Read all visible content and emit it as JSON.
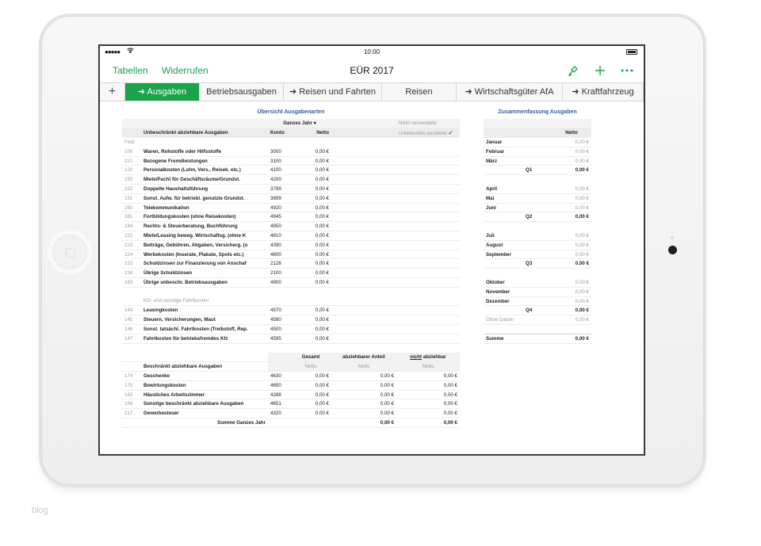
{
  "footer": {
    "watermark": "blog"
  },
  "status": {
    "signal": "●●●●●",
    "time": "10:00"
  },
  "toolbar": {
    "left": [
      "Tabellen",
      "Widerrufen"
    ],
    "title": "EÜR 2017"
  },
  "tabs": [
    "➜ Ausgaben",
    "Betriebsausgaben",
    "➜ Reisen und Fahrten",
    "Reisen",
    "➜ Wirtschaftsgüter AfA",
    "➜ Kraftfahrzeug"
  ],
  "active_tab": 0,
  "overview": {
    "title": "Übersicht Ausgabenarten",
    "period": "Ganzes Jahr ▾",
    "option_unused": "Nicht verwendete",
    "option_hide": "Unterkonten ausblend",
    "option_check": "✓",
    "header": {
      "label": "Unbeschränkt abziehbare Ausgaben",
      "konto": "Konto",
      "netto": "Netto"
    },
    "feld": "Feld",
    "rows": [
      {
        "feld": "100",
        "label": "Waren, Rohstoffe oder Hilfsstoffe",
        "konto": "3000",
        "netto": "0,00 €"
      },
      {
        "feld": "110",
        "label": "Bezogene Fremdleistungen",
        "konto": "3100",
        "netto": "0,00 €"
      },
      {
        "feld": "120",
        "label": "Personalkosten (Lohn, Vers., Reisek. etc.)",
        "konto": "4100",
        "netto": "0,00 €"
      },
      {
        "feld": "150",
        "label": "Miete/Pacht für Geschäftsräume/Grundst.",
        "konto": "4200",
        "netto": "0,00 €"
      },
      {
        "feld": "152",
        "label": "Doppelte Haushaltsführung",
        "konto": "3799",
        "netto": "0,00 €"
      },
      {
        "feld": "151",
        "label": "Sonst. Aufw. für betriebl. genutzte Grundst.",
        "konto": "3899",
        "netto": "0,00 €"
      },
      {
        "feld": "280",
        "label": "Telekommunikation",
        "konto": "4920",
        "netto": "0,00 €"
      },
      {
        "feld": "281",
        "label": "Fortbildungskosten (ohne Reisekosten)",
        "konto": "4945",
        "netto": "0,00 €"
      },
      {
        "feld": "184",
        "label": "Rechts- & Steuerberatung, Buchführung",
        "konto": "4950",
        "netto": "0,00 €"
      },
      {
        "feld": "222",
        "label": "Miete/Leasing beweg. Wirtschaftsg. (ohne K",
        "konto": "4810",
        "netto": "0,00 €"
      },
      {
        "feld": "223",
        "label": "Beiträge, Gebühren, Abgaben, Versicherg. (o",
        "konto": "4390",
        "netto": "0,00 €"
      },
      {
        "feld": "224",
        "label": "Werbekosten (Inserate, Plakate, Spots etc.)",
        "konto": "4600",
        "netto": "0,00 €"
      },
      {
        "feld": "232",
        "label": "Schuldzinsen zur Finanzierung von Anschaf",
        "konto": "2126",
        "netto": "0,00 €"
      },
      {
        "feld": "234",
        "label": "Übrige Schuldzinsen",
        "konto": "2100",
        "netto": "0,00 €"
      },
      {
        "feld": "183",
        "label": "Übrige unbeschr. Betriebsausgaben",
        "konto": "4900",
        "netto": "0,00 €"
      }
    ],
    "kfz_label": "Kfz- und sonstige Fahrtkosten",
    "kfz_rows": [
      {
        "feld": "144",
        "label": "Leasingkosten",
        "konto": "4570",
        "netto": "0,00 €"
      },
      {
        "feld": "145",
        "label": "Steuern, Versicherungen, Maut",
        "konto": "4580",
        "netto": "0,00 €"
      },
      {
        "feld": "146",
        "label": "Sonst. tatsächl. Fahrtkosten (Treibstoff, Rep.",
        "konto": "4500",
        "netto": "0,00 €"
      },
      {
        "feld": "147",
        "label": "Fahrtkosten für betriebsfremdes Kfz",
        "konto": "4595",
        "netto": "0,00 €"
      }
    ],
    "beschr": {
      "label": "Beschränkt abziehbare Ausgaben",
      "col_gesamt": "Gesamt",
      "col_anteil": "abziehbarer Anteil",
      "col_nicht": "nicht",
      "col_nicht_rest": " abziehbar",
      "netto": "Netto",
      "rows": [
        {
          "feld": "174",
          "label": "Geschenke",
          "konto": "4630",
          "gesamt": "0,00 €",
          "anteil": "0,00 €",
          "nicht": "0,00 €"
        },
        {
          "feld": "175",
          "label": "Bewirtungskosten",
          "konto": "4650",
          "gesamt": "0,00 €",
          "anteil": "0,00 €",
          "nicht": "0,00 €"
        },
        {
          "feld": "162",
          "label": "Häusliches Arbeitszimmer",
          "konto": "4288",
          "gesamt": "0,00 €",
          "anteil": "0,00 €",
          "nicht": "0,00 €"
        },
        {
          "feld": "168",
          "label": "Sonstige beschränkt abziehbare Ausgaben",
          "konto": "4651",
          "gesamt": "0,00 €",
          "anteil": "0,00 €",
          "nicht": "0,00 €"
        },
        {
          "feld": "217",
          "label": "Gewerbesteuer",
          "konto": "4320",
          "gesamt": "0,00 €",
          "anteil": "0,00 €",
          "nicht": "0,00 €"
        }
      ],
      "sum_label": "Summe Ganzes Jahr",
      "sum_anteil": "0,00 €",
      "sum_nicht": "0,00 €"
    }
  },
  "summary": {
    "title": "Zusammenfassung Ausgaben",
    "netto": "Netto",
    "months": [
      {
        "label": "Januar",
        "value": "0,00 €"
      },
      {
        "label": "Februar",
        "value": "0,00 €"
      },
      {
        "label": "März",
        "value": "0,00 €"
      },
      {
        "quarter": "Q1",
        "value": "0,00 €"
      },
      {
        "label": "April",
        "value": "0,00 €"
      },
      {
        "label": "Mai",
        "value": "0,00 €"
      },
      {
        "label": "Juni",
        "value": "0,00 €"
      },
      {
        "quarter": "Q2",
        "value": "0,00 €"
      },
      {
        "label": "Juli",
        "value": "0,00 €"
      },
      {
        "label": "August",
        "value": "0,00 €"
      },
      {
        "label": "September",
        "value": "0,00 €"
      },
      {
        "quarter": "Q3",
        "value": "0,00 €"
      },
      {
        "label": "Oktober",
        "value": "0,00 €"
      },
      {
        "label": "November",
        "value": "0,00 €"
      },
      {
        "label": "Dezember",
        "value": "0,00 €"
      },
      {
        "quarter": "Q4",
        "value": "0,00 €"
      }
    ],
    "ohne_datum": "Ohne Datum",
    "ohne_value": "0,00 €",
    "summe_label": "Summe",
    "summe_value": "0,00 €"
  },
  "icons": {
    "share": "brush-share-icon",
    "add": "plus-icon",
    "more": "ellipsis-icon"
  },
  "colors": {
    "accent": "#1aa34a",
    "heading": "#2b5fa8"
  }
}
